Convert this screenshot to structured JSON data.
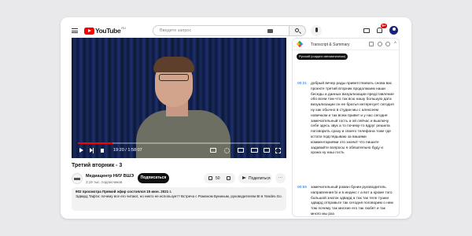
{
  "header": {
    "logo_text": "YouTube",
    "logo_region": "RU",
    "search_placeholder": "Введите запрос",
    "notification_count": "9+"
  },
  "player": {
    "time": "19:20 / 1:58:07",
    "progress": 0.17
  },
  "video": {
    "title": "Третий вторник - 3",
    "channel_name": "Медиацентр НИУ ВШЭ",
    "subscribers": "3,19 тыс. подписчиков",
    "subscribe_label": "Подписаться",
    "like_count": "50",
    "share_label": "Поделиться",
    "more_label": "···",
    "description_stats": "902 просмотра  Прямой эфир состоялся 15 июн. 2021 г.",
    "description_text": "Эдвард Тафти: почему все его читают, но никто не использует? Встреча с Романом Буниным, руководителем BI в Yandex.Go."
  },
  "transcript": {
    "title": "Transcript & Summary",
    "language_chip": "Русский (создано автоматически)",
    "collapse_label": "^",
    "segments": [
      {
        "time": "00:21",
        "text": "добрый вечер рады приветствовать снова вас проекте третий вторник продолжаем наши беседы и данных визуализации представление обо всем том что так всю нашу большую дата визуализации он ее братья интересует сегодня ну как обычно в студии мы с алексеем новичком и так всем привет и у нас сегодня замечательный гость а ой сейчас и выключу себе здесь звук а то почему-то вдруг решила поговорить сразу и своего телефона тоже где кстати подглядываю за вашими комментариями это значит что пишите задавайте вопросы я обязательно буду и храна ну наш гость"
      },
      {
        "time": "00:55",
        "text": "замечательный роман бунин руководитель направления bi и в индекс г а вот а кроме того большой знаток эдвард а так так теле тушки эдвард отправьте так сегодня поговорим о нем том почему так многие его так любят и так много мы раз"
      }
    ]
  },
  "colors": {
    "accent_red": "#ff0000",
    "timestamp_blue": "#1a66d6",
    "subscribe_bg": "#0f0f0f"
  }
}
